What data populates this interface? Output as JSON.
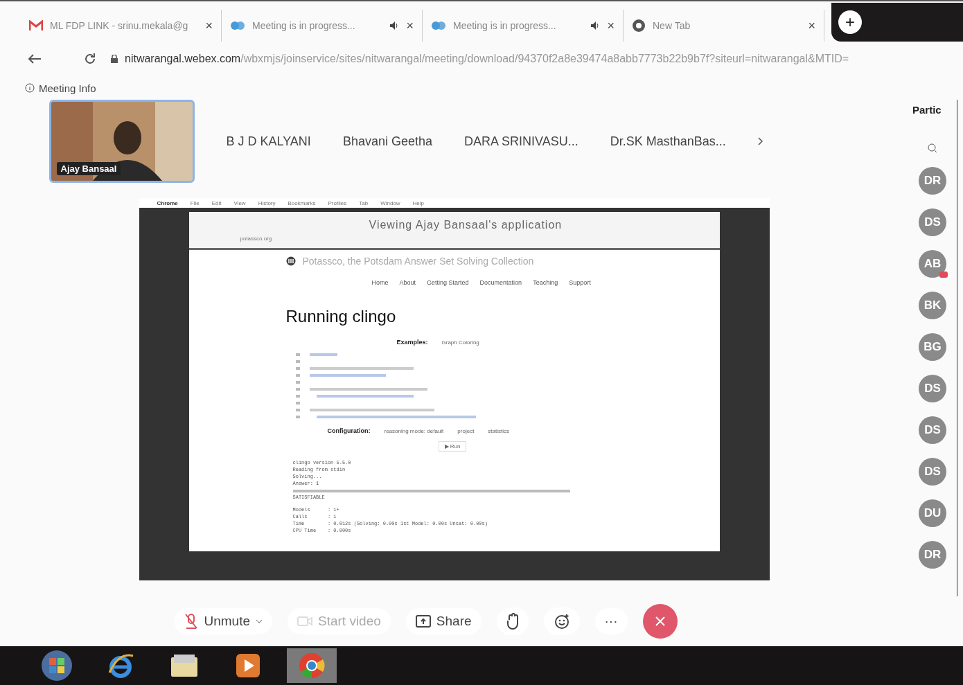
{
  "browser": {
    "tabs": [
      {
        "title": "ML FDP LINK - srinu.mekala@g",
        "kind": "mail",
        "audio": false,
        "close": "×"
      },
      {
        "title": "Meeting is in progress...",
        "kind": "webex",
        "audio": true,
        "close": "×"
      },
      {
        "title": "Meeting is in progress...",
        "kind": "webex",
        "audio": true,
        "close": "×"
      },
      {
        "title": "New Tab",
        "kind": "chrome",
        "audio": false,
        "close": "×"
      }
    ],
    "new_tab": "+",
    "address": {
      "domain": "nitwarangal.webex.com",
      "path": "/wbxmjs/joinservice/sites/nitwarangal/meeting/download/94370f2a8e39474a8abb7773b22b9b7f?siteurl=nitwarangal&MTID="
    }
  },
  "meeting_info": "Meeting Info",
  "participant_strip": {
    "video": {
      "name": "Ajay Bansaal"
    },
    "names": [
      "B J D KALYANI",
      "Bhavani Geetha",
      "DARA SRINIVASU...",
      "Dr.SK MasthanBas..."
    ]
  },
  "shared_screen": {
    "mac_menu": [
      "Chrome",
      "File",
      "Edit",
      "View",
      "History",
      "Bookmarks",
      "Profiles",
      "Tab",
      "Window",
      "Help"
    ],
    "banner": "Viewing Ajay Bansaal's application",
    "site_url": "potassco.org",
    "site_title": "Potassco, the Potsdam Answer Set Solving Collection",
    "nav": [
      "Home",
      "About",
      "Getting Started",
      "Documentation",
      "Teaching",
      "Support"
    ],
    "heading": "Running clingo",
    "examples_label": "Examples:",
    "examples_value": "Graph Coloring",
    "config_label": "Configuration:",
    "config_options": [
      "reasoning mode: default",
      "project",
      "statistics"
    ],
    "run_button": "▶ Run",
    "output": [
      {
        "kind": "text",
        "text": "clingo version 5.5.0"
      },
      {
        "kind": "text",
        "text": "Reading from stdin"
      },
      {
        "kind": "text",
        "text": "Solving..."
      },
      {
        "kind": "text",
        "text": "Answer: 1"
      },
      {
        "kind": "blurred"
      },
      {
        "kind": "text",
        "text": "SATISFIABLE"
      }
    ],
    "stats": [
      "Models      : 1+",
      "Calls       : 1",
      "Time        : 0.012s (Solving: 0.00s 1st Model: 0.00s Unsat: 0.00s)",
      "CPU Time    : 0.000s"
    ]
  },
  "participants": {
    "title": "Partic",
    "avatars": [
      {
        "initials": "DR",
        "badge": false
      },
      {
        "initials": "DS",
        "badge": false
      },
      {
        "initials": "AB",
        "badge": true
      },
      {
        "initials": "BK",
        "badge": false
      },
      {
        "initials": "BG",
        "badge": false
      },
      {
        "initials": "DS",
        "badge": false
      },
      {
        "initials": "DS",
        "badge": false
      },
      {
        "initials": "DS",
        "badge": false
      },
      {
        "initials": "DU",
        "badge": false
      },
      {
        "initials": "DR",
        "badge": false
      }
    ]
  },
  "controls": [
    {
      "kind": "mute",
      "label": "Unmute"
    },
    {
      "kind": "video",
      "label": "Start video",
      "disabled": true
    },
    {
      "kind": "share",
      "label": "Share"
    },
    {
      "kind": "hand"
    },
    {
      "kind": "reaction"
    },
    {
      "kind": "more",
      "label": "···"
    },
    {
      "kind": "leave"
    }
  ],
  "taskbar": [
    {
      "kind": "start",
      "selected": false
    },
    {
      "kind": "ie",
      "selected": false
    },
    {
      "kind": "folder",
      "selected": false
    },
    {
      "kind": "media",
      "selected": false
    },
    {
      "kind": "chrome",
      "selected": true
    }
  ]
}
